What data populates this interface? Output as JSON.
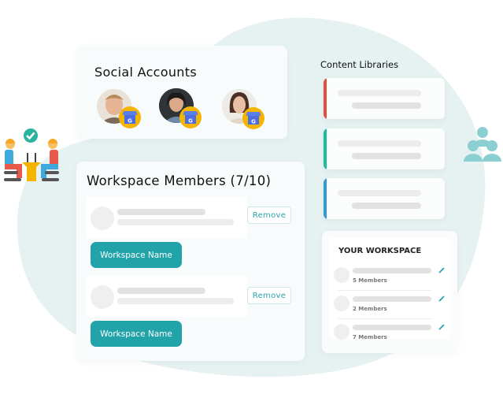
{
  "social_accounts": {
    "title": "Social Accounts",
    "accounts": [
      {
        "avatar": "avatar-person-1",
        "badge_icon": "google-my-business-icon"
      },
      {
        "avatar": "avatar-person-2",
        "badge_icon": "google-my-business-icon"
      },
      {
        "avatar": "avatar-person-3",
        "badge_icon": "google-my-business-icon"
      }
    ]
  },
  "workspace_members": {
    "title": "Workspace Members (7/10)",
    "members": [
      {
        "remove_label": "Remove",
        "workspace_label": "Workspace Name"
      },
      {
        "remove_label": "Remove",
        "workspace_label": "Workspace Name"
      }
    ]
  },
  "content_libraries": {
    "title": "Content Libraries",
    "items": [
      {
        "accent": "#e74c3c"
      },
      {
        "accent": "#1abc9c"
      },
      {
        "accent": "#3498db"
      }
    ]
  },
  "your_workspace": {
    "title": "YOUR WORKSPACE",
    "items": [
      {
        "members": "5 Members"
      },
      {
        "members": "2 Members"
      },
      {
        "members": "7 Members"
      }
    ]
  },
  "colors": {
    "primary": "#22a3a9",
    "blob": "#e6f1f1",
    "badge": "#f5b400",
    "gmb_blue": "#4a6ee0"
  }
}
